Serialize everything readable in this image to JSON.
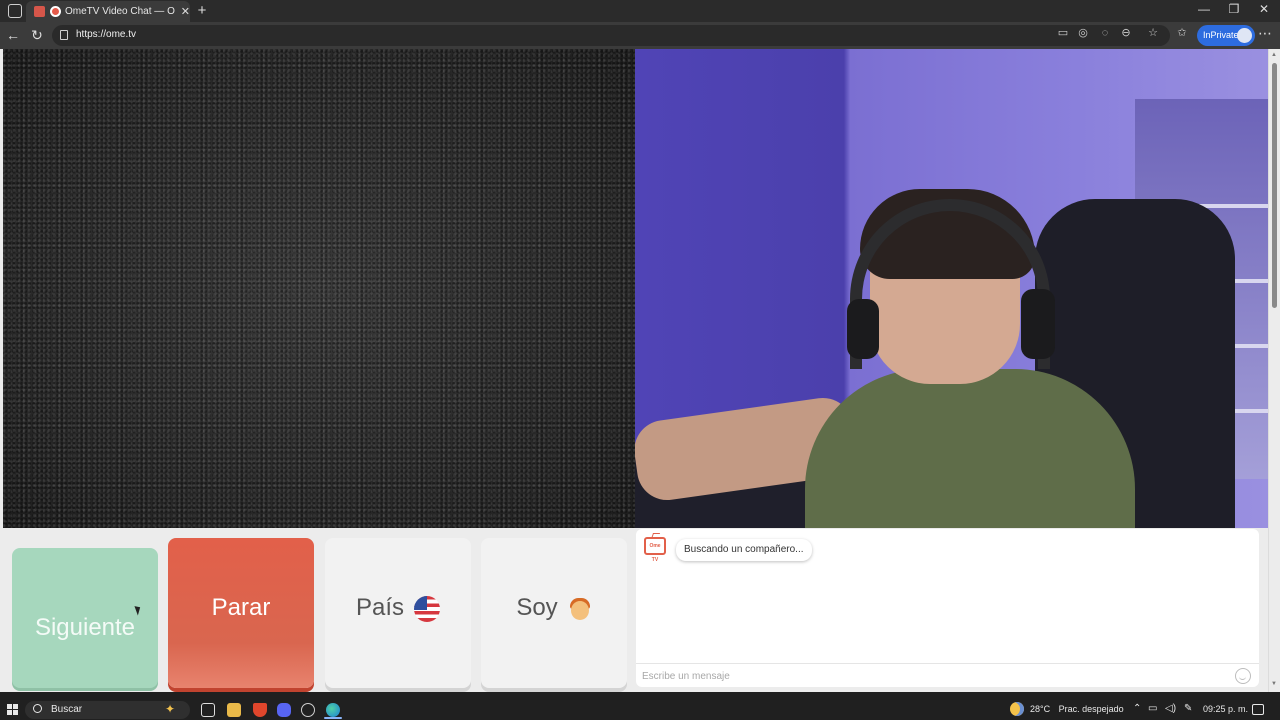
{
  "browser": {
    "tab_title": "OmeTV Video Chat — Omegle",
    "tab_close": "✕",
    "new_tab": "+",
    "url": "https://ome.tv",
    "inprivate_label": "InPrivate",
    "more": "⋯",
    "window_controls": {
      "minimize": "—",
      "maximize": "❐",
      "close": "✕"
    },
    "nav": {
      "back": "←",
      "refresh": "↻"
    }
  },
  "controls": {
    "next_label": "Siguiente",
    "stop_label": "Parar",
    "country_label": "País",
    "country_flag_icon": "us-flag-icon",
    "me_label": "Soy",
    "me_icon": "boy-emoji-icon"
  },
  "chat": {
    "logo_text": "Ome TV",
    "status_message": "Buscando un compañero...",
    "input_placeholder": "Escribe un mensaje"
  },
  "taskbar": {
    "search_label": "Buscar",
    "temperature": "28°C",
    "weather_text": "Prac. despejado",
    "time": "09:25 p. m."
  },
  "colors": {
    "next_button": "#a6d7bd",
    "stop_button": "#e2604a",
    "browser_accent": "#2d6cdf"
  }
}
